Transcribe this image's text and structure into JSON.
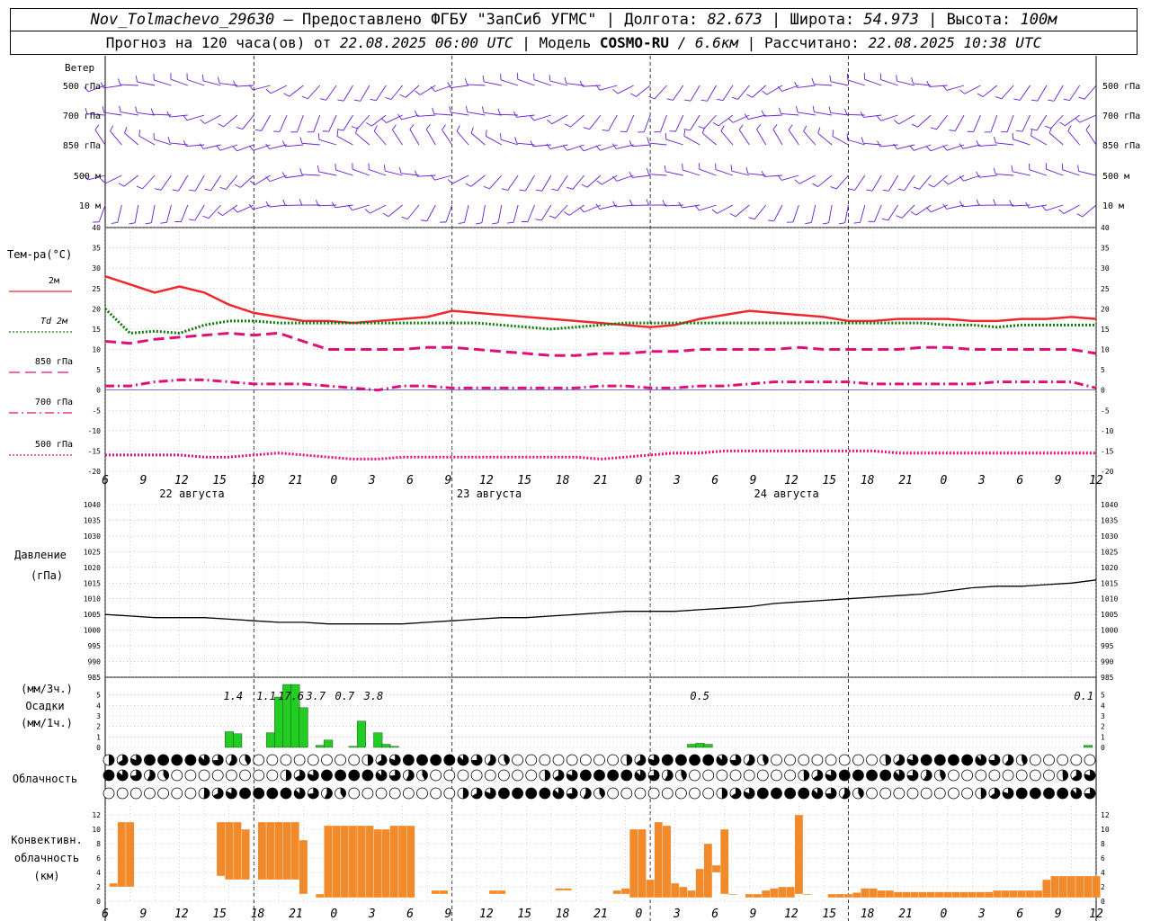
{
  "header": {
    "station": "Nov_Tolmachevo_29630",
    "provider": "– Предоставлено ФГБУ \"ЗапСиб УГМС\" |",
    "lon_label": "Долгота:",
    "lon": "82.673",
    "lat_label": "| Широта:",
    "lat": "54.973",
    "alt_label": "| Высота:",
    "alt": "100м",
    "fc_label": "Прогноз на 120 часа(ов) от",
    "fc_time": "22.08.2025 06:00 UTC",
    "model_label": "| Модель",
    "model": "COSMO-RU",
    "res": "/ 6.6км",
    "calc_label": "| Рассчитано:",
    "calc_time": "22.08.2025 10:38 UTC"
  },
  "wind_panel": {
    "title": "Ветер",
    "levels": [
      "500 гПа",
      "700 гПа",
      "850 гПа",
      "500 м",
      "10 м"
    ]
  },
  "temp_panel": {
    "title": "Тем-ра(°C)",
    "legend": [
      {
        "label": "2м",
        "color": "#f0282d",
        "style": "solid"
      },
      {
        "label": "Td 2м",
        "color": "#0a7a0a",
        "style": "dotted"
      },
      {
        "label": "850 гПа",
        "color": "#e0107a",
        "style": "dashed"
      },
      {
        "label": "700 гПа",
        "color": "#e0107a",
        "style": "dashdot"
      },
      {
        "label": "500 гПа",
        "color": "#e0107a",
        "style": "dotted"
      }
    ]
  },
  "time_axis": {
    "hours": [
      "6",
      "9",
      "12",
      "15",
      "18",
      "21",
      "0",
      "3",
      "6",
      "9",
      "12",
      "15",
      "18",
      "21",
      "0",
      "3",
      "6",
      "9",
      "12",
      "15",
      "18",
      "21",
      "0",
      "3",
      "6",
      "9",
      "12"
    ],
    "dates": [
      "22 августа",
      "23 августа",
      "24 августа"
    ]
  },
  "pressure_panel": {
    "title": "Давление",
    "unit": "(гПа)"
  },
  "precip_panel": {
    "unit1": "(мм/3ч.)",
    "title": "Осадки",
    "unit2": "(мм/1ч.)"
  },
  "cloud_panel": {
    "title": "Облачность"
  },
  "conv_panel": {
    "title1": "Конвективн.",
    "title2": "облачность",
    "unit": "(км)"
  },
  "colors": {
    "temp2m": "#f0282d",
    "dew": "#0a7a0a",
    "upper": "#e0107a",
    "wind": "#6a1bd1",
    "precip": "#22cc22",
    "conv": "#f08a2a",
    "pressure": "#000000"
  },
  "chart_data": [
    {
      "type": "line",
      "title": "Тем-ра(°C)",
      "x_hours_from_start": [
        0,
        3,
        6,
        9,
        12,
        15,
        18,
        21,
        24,
        27,
        30,
        33,
        36,
        39,
        42,
        45,
        48,
        51,
        54,
        57,
        60,
        63,
        66,
        69,
        72,
        75,
        78,
        81,
        84,
        87,
        90,
        93,
        96,
        99,
        102,
        105,
        108,
        111,
        114,
        117,
        120
      ],
      "ylim": [
        -20,
        40
      ],
      "series": [
        {
          "name": "2м",
          "values": [
            28,
            26,
            24,
            25.5,
            24,
            21,
            19,
            18,
            17,
            17,
            16.5,
            17,
            17.5,
            18,
            19.5,
            19,
            18.5,
            18,
            17.5,
            17,
            16.5,
            16,
            15.5,
            16,
            17.5,
            18.5,
            19.5,
            19,
            18.5,
            18,
            17,
            17,
            17.5,
            17.5,
            17.5,
            17,
            17,
            17.5,
            17.5,
            18,
            17.5
          ]
        },
        {
          "name": "Td 2м",
          "values": [
            20,
            14,
            14.5,
            14,
            16,
            17,
            17,
            16.5,
            16.5,
            16.5,
            16.5,
            16.5,
            16.5,
            16.5,
            16.5,
            16.5,
            16,
            15.5,
            15,
            15.5,
            16,
            16.5,
            16.5,
            16.5,
            16.5,
            16.5,
            16.5,
            16.5,
            16.5,
            16.5,
            16.5,
            16.5,
            16.5,
            16.5,
            16,
            16,
            15.5,
            16,
            16,
            16,
            16
          ]
        },
        {
          "name": "850 гПа",
          "values": [
            12,
            11.5,
            12.5,
            13,
            13.5,
            14,
            13.5,
            14,
            12,
            10,
            10,
            10,
            10,
            10.5,
            10.5,
            10,
            9.5,
            9,
            8.5,
            8.5,
            9,
            9,
            9.5,
            9.5,
            10,
            10,
            10,
            10,
            10.5,
            10,
            10,
            10,
            10,
            10.5,
            10.5,
            10,
            10,
            10,
            10,
            10,
            9
          ]
        },
        {
          "name": "700 гПа",
          "values": [
            1,
            1,
            2,
            2.5,
            2.5,
            2,
            1.5,
            1.5,
            1.5,
            1,
            0.5,
            0,
            1,
            1,
            0.5,
            0.5,
            0.5,
            0.5,
            0.5,
            0.5,
            1,
            1,
            0.5,
            0.5,
            1,
            1,
            1.5,
            2,
            2,
            2,
            2,
            1.5,
            1.5,
            1.5,
            1.5,
            1.5,
            2,
            2,
            2,
            2,
            0.5
          ]
        },
        {
          "name": "500 гПа",
          "values": [
            -16,
            -16,
            -16,
            -16,
            -16.5,
            -16.5,
            -16,
            -15.5,
            -16,
            -16.5,
            -17,
            -17,
            -16.5,
            -16.5,
            -16.5,
            -16.5,
            -16.5,
            -16.5,
            -16.5,
            -16.5,
            -17,
            -16.5,
            -16,
            -15.5,
            -15.5,
            -15,
            -15,
            -15,
            -15,
            -15,
            -15,
            -15,
            -15.5,
            -15.5,
            -15.5,
            -15.5,
            -15.5,
            -15.5,
            -15.5,
            -15.5,
            -15.5
          ]
        }
      ]
    },
    {
      "type": "line",
      "title": "Давление",
      "ylabel": "(гПа)",
      "ylim": [
        985,
        1040
      ],
      "x_hours_from_start": [
        0,
        3,
        6,
        9,
        12,
        15,
        18,
        21,
        24,
        27,
        30,
        33,
        36,
        39,
        42,
        45,
        48,
        51,
        54,
        57,
        60,
        63,
        66,
        69,
        72,
        75,
        78,
        81,
        84,
        87,
        90,
        93,
        96,
        99,
        102,
        105,
        108,
        111,
        114,
        117,
        120
      ],
      "series": [
        {
          "name": "",
          "values": [
            1005,
            1004.5,
            1004,
            1004,
            1004,
            1003.5,
            1003,
            1002.5,
            1002.5,
            1002,
            1002,
            1002,
            1002,
            1002.5,
            1003,
            1003.5,
            1004,
            1004,
            1004.5,
            1005,
            1005.5,
            1006,
            1006,
            1006,
            1006.5,
            1007,
            1007.5,
            1008.5,
            1009,
            1009.5,
            1010,
            1010.5,
            1011,
            1011.5,
            1012.5,
            1013.5,
            1014,
            1014,
            1014.5,
            1015,
            1016
          ]
        }
      ]
    },
    {
      "type": "bar",
      "title": "Осадки",
      "ylim": [
        0,
        6
      ],
      "x_hours_from_start": [
        15,
        16,
        20,
        21,
        22,
        23,
        24,
        26,
        27,
        30,
        31,
        33,
        34,
        35,
        71,
        72,
        73,
        119
      ],
      "values": [
        1.5,
        1.3,
        1.4,
        4.8,
        6,
        6,
        3.8,
        0.2,
        0.7,
        0.1,
        2.5,
        1.4,
        0.3,
        0.1,
        0.3,
        0.4,
        0.3,
        0.2
      ],
      "labels": [
        {
          "x": 15.5,
          "text": "1.4"
        },
        {
          "x": 19.5,
          "text": "1.1"
        },
        {
          "x": 22.5,
          "text": "17.6"
        },
        {
          "x": 25.5,
          "text": "3.7"
        },
        {
          "x": 29,
          "text": "0.7"
        },
        {
          "x": 32.5,
          "text": "3.8"
        },
        {
          "x": 72,
          "text": "0.5"
        },
        {
          "x": 118.5,
          "text": "0.1"
        }
      ]
    },
    {
      "type": "bar",
      "title": "Конвективн. облачность",
      "ylabel": "(км)",
      "ylim": [
        0,
        13
      ],
      "x_hours_from_start": [
        1,
        2,
        3,
        14,
        15,
        16,
        17,
        19,
        20,
        21,
        22,
        23,
        24,
        26,
        27,
        28,
        29,
        30,
        31,
        32,
        33,
        34,
        35,
        36,
        37,
        40,
        41,
        47,
        48,
        55,
        56,
        62,
        63,
        64,
        65,
        66,
        67,
        68,
        69,
        70,
        71,
        72,
        73,
        74,
        75,
        76,
        78,
        79,
        80,
        81,
        82,
        83,
        84,
        85,
        88,
        89,
        90,
        91,
        92,
        93,
        94,
        95,
        96,
        97,
        98,
        99,
        100,
        101,
        102,
        103,
        104,
        105,
        106,
        107,
        108,
        109,
        110,
        111,
        112,
        113,
        114,
        115,
        116,
        117,
        118,
        119,
        120
      ],
      "bottoms": [
        2,
        2,
        2,
        3.5,
        3,
        3,
        3,
        3,
        3,
        3,
        3,
        3,
        1,
        0.5,
        0.5,
        0.5,
        0.5,
        0.5,
        0.5,
        0.5,
        0.5,
        0.5,
        0.5,
        0.5,
        0.5,
        1,
        1,
        1,
        1,
        1.5,
        1.5,
        1,
        1,
        0.5,
        0.5,
        0.5,
        0.5,
        0.5,
        0.5,
        0.5,
        0.5,
        0.5,
        0.5,
        4,
        1,
        1,
        0.5,
        0.5,
        0.5,
        0.5,
        0.5,
        0.5,
        1,
        1,
        0.5,
        0.5,
        0.5,
        0.5,
        0.5,
        0.5,
        0.5,
        0.5,
        0.5,
        0.5,
        0.5,
        0.5,
        0.5,
        0.5,
        0.5,
        0.5,
        0.5,
        0.5,
        0.5,
        0.5,
        0.5,
        0.5,
        0.5,
        0.5,
        0.5,
        0.5,
        0.5,
        0.5,
        0.5,
        0.5,
        0.5,
        0.5,
        0.5
      ],
      "tops": [
        2.5,
        11,
        11,
        11,
        11,
        11,
        10,
        11,
        11,
        11,
        11,
        11,
        8.5,
        1,
        10.5,
        10.5,
        10.5,
        10.5,
        10.5,
        10.5,
        10,
        10,
        10.5,
        10.5,
        10.5,
        1.5,
        1.5,
        1.5,
        1.5,
        1.8,
        1.8,
        1.5,
        1.8,
        10,
        10,
        3,
        11,
        10.5,
        2.5,
        2,
        1.5,
        4.5,
        8,
        5,
        10,
        1,
        1,
        1,
        1.5,
        1.8,
        2,
        2,
        12,
        1,
        1,
        1,
        1,
        1.2,
        1.8,
        1.8,
        1.5,
        1.5,
        1.3,
        1.3,
        1.3,
        1.3,
        1.3,
        1.3,
        1.3,
        1.3,
        1.3,
        1.3,
        1.3,
        1.3,
        1.5,
        1.5,
        1.5,
        1.5,
        1.5,
        1.5,
        3,
        3.5,
        3.5,
        3.5,
        3.5,
        3.5,
        3.5
      ]
    }
  ]
}
